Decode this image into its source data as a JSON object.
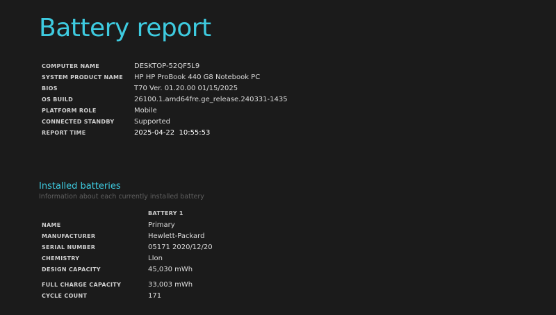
{
  "title": "Battery report",
  "system_info": [
    {
      "label": "COMPUTER NAME",
      "value": "DESKTOP-52QF5L9"
    },
    {
      "label": "SYSTEM PRODUCT NAME",
      "value": "HP HP ProBook 440 G8 Notebook PC"
    },
    {
      "label": "BIOS",
      "value": "T70 Ver. 01.20.00 01/15/2025"
    },
    {
      "label": "OS BUILD",
      "value": "26100.1.amd64fre.ge_release.240331-1435"
    },
    {
      "label": "PLATFORM ROLE",
      "value": "Mobile"
    },
    {
      "label": "CONNECTED STANDBY",
      "value": "Supported"
    },
    {
      "label": "REPORT TIME",
      "value": "2025-04-22  10:55:53"
    }
  ],
  "installed_batteries": {
    "title": "Installed batteries",
    "subtitle": "Information about each currently installed battery",
    "column_header": "BATTERY 1",
    "rows": [
      {
        "label": "NAME",
        "value": "Primary"
      },
      {
        "label": "MANUFACTURER",
        "value": "Hewlett-Packard"
      },
      {
        "label": "SERIAL NUMBER",
        "value": "05171 2020/12/20"
      },
      {
        "label": "CHEMISTRY",
        "value": "LIon"
      },
      {
        "label": "DESIGN CAPACITY",
        "value": "45,030 mWh"
      },
      {
        "label": "FULL CHARGE CAPACITY",
        "value": "33,003 mWh"
      },
      {
        "label": "CYCLE COUNT",
        "value": "171"
      }
    ]
  },
  "colors": {
    "background": "#1b1b1b",
    "accent": "#3ecbe0",
    "text": "#dcdcdc",
    "muted": "#5f5f5f"
  }
}
